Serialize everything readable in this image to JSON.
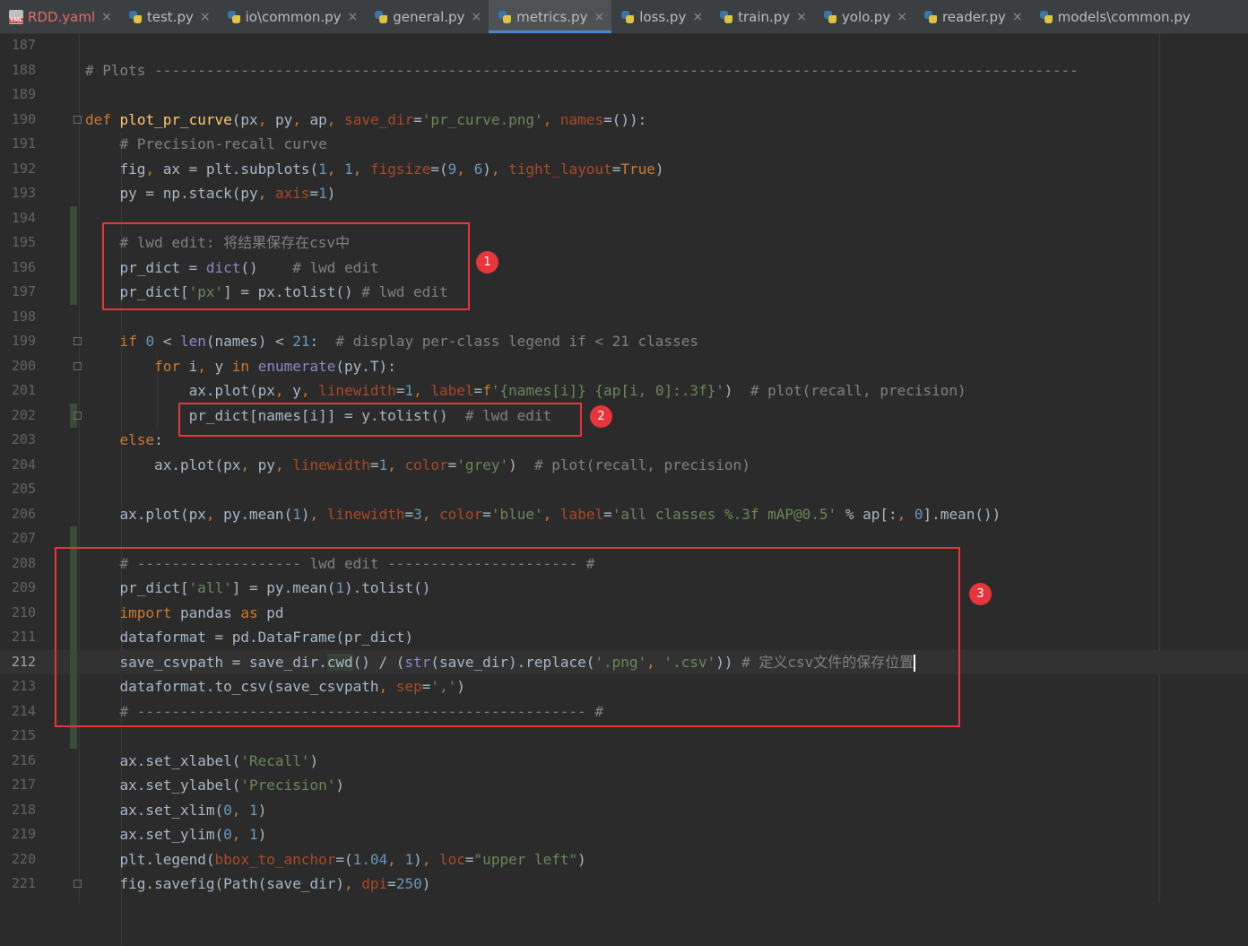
{
  "tabs": [
    {
      "label": "RDD.yaml",
      "icon": "yaml-file-icon",
      "active": false
    },
    {
      "label": "test.py",
      "icon": "python-file-icon",
      "active": false
    },
    {
      "label": "io\\common.py",
      "icon": "python-file-icon",
      "active": false
    },
    {
      "label": "general.py",
      "icon": "python-file-icon",
      "active": false
    },
    {
      "label": "metrics.py",
      "icon": "python-file-icon",
      "active": true
    },
    {
      "label": "loss.py",
      "icon": "python-file-icon",
      "active": false
    },
    {
      "label": "train.py",
      "icon": "python-file-icon",
      "active": false
    },
    {
      "label": "yolo.py",
      "icon": "python-file-icon",
      "active": false
    },
    {
      "label": "reader.py",
      "icon": "python-file-icon",
      "active": false
    },
    {
      "label": "models\\common.py",
      "icon": "python-file-icon",
      "active": false
    }
  ],
  "tab_close_glyph": "×",
  "editor": {
    "current_line": "212",
    "lines": [
      {
        "n": "187",
        "t": ""
      },
      {
        "n": "188",
        "t": "# Plots -----------------------------------------------------------------------------------------------------------"
      },
      {
        "n": "189",
        "t": ""
      },
      {
        "n": "190",
        "t": "def plot_pr_curve(px, py, ap, save_dir='pr_curve.png', names=()):"
      },
      {
        "n": "191",
        "t": "    # Precision-recall curve"
      },
      {
        "n": "192",
        "t": "    fig, ax = plt.subplots(1, 1, figsize=(9, 6), tight_layout=True)"
      },
      {
        "n": "193",
        "t": "    py = np.stack(py, axis=1)"
      },
      {
        "n": "194",
        "t": ""
      },
      {
        "n": "195",
        "t": "    # lwd edit: 将结果保存在csv中"
      },
      {
        "n": "196",
        "t": "    pr_dict = dict()    # lwd edit"
      },
      {
        "n": "197",
        "t": "    pr_dict['px'] = px.tolist() # lwd edit"
      },
      {
        "n": "198",
        "t": ""
      },
      {
        "n": "199",
        "t": "    if 0 < len(names) < 21:  # display per-class legend if < 21 classes"
      },
      {
        "n": "200",
        "t": "        for i, y in enumerate(py.T):"
      },
      {
        "n": "201",
        "t": "            ax.plot(px, y, linewidth=1, label=f'{names[i]} {ap[i, 0]:.3f}')  # plot(recall, precision)"
      },
      {
        "n": "202",
        "t": "            pr_dict[names[i]] = y.tolist()  # lwd edit"
      },
      {
        "n": "203",
        "t": "    else:"
      },
      {
        "n": "204",
        "t": "        ax.plot(px, py, linewidth=1, color='grey')  # plot(recall, precision)"
      },
      {
        "n": "205",
        "t": ""
      },
      {
        "n": "206",
        "t": "    ax.plot(px, py.mean(1), linewidth=3, color='blue', label='all classes %.3f mAP@0.5' % ap[:, 0].mean())"
      },
      {
        "n": "207",
        "t": ""
      },
      {
        "n": "208",
        "t": "    # ------------------- lwd edit ---------------------- #"
      },
      {
        "n": "209",
        "t": "    pr_dict['all'] = py.mean(1).tolist()"
      },
      {
        "n": "210",
        "t": "    import pandas as pd"
      },
      {
        "n": "211",
        "t": "    dataformat = pd.DataFrame(pr_dict)"
      },
      {
        "n": "212",
        "t": "    save_csvpath = save_dir.cwd() / (str(save_dir).replace('.png', '.csv')) # 定义csv文件的保存位置"
      },
      {
        "n": "213",
        "t": "    dataformat.to_csv(save_csvpath, sep=',')"
      },
      {
        "n": "214",
        "t": "    # ---------------------------------------------------- #"
      },
      {
        "n": "215",
        "t": ""
      },
      {
        "n": "216",
        "t": "    ax.set_xlabel('Recall')"
      },
      {
        "n": "217",
        "t": "    ax.set_ylabel('Precision')"
      },
      {
        "n": "218",
        "t": "    ax.set_xlim(0, 1)"
      },
      {
        "n": "219",
        "t": "    ax.set_ylim(0, 1)"
      },
      {
        "n": "220",
        "t": "    plt.legend(bbox_to_anchor=(1.04, 1), loc=\"upper left\")"
      },
      {
        "n": "221",
        "t": "    fig.savefig(Path(save_dir), dpi=250)"
      }
    ]
  },
  "annotations": [
    {
      "label": "1"
    },
    {
      "label": "2"
    },
    {
      "label": "3"
    }
  ],
  "colors": {
    "editor_bg": "#2b2b2b",
    "keyword": "#cc7832",
    "function_name": "#ffc66d",
    "comment": "#808080",
    "string": "#6a8759",
    "number": "#6897bb",
    "kwarg": "#aa4926",
    "annotation_red": "#e8343a",
    "active_tab_underline": "#4a88c7"
  }
}
